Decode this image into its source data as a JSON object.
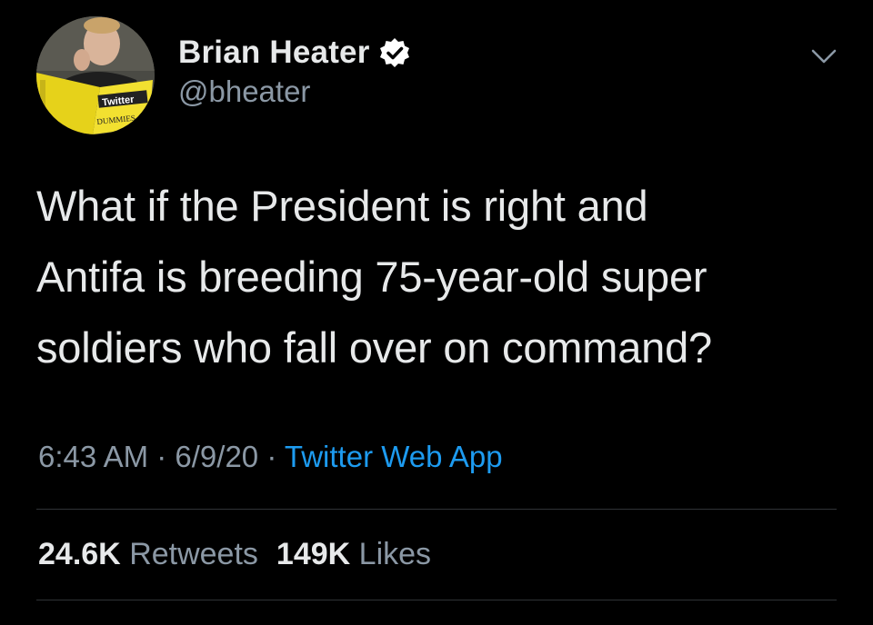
{
  "author": {
    "display_name": "Brian Heater",
    "handle": "@bheater",
    "avatar_book_title": "Twitter",
    "avatar_book_subtitle": "DUMMIES"
  },
  "tweet": {
    "text_lines": [
      "What if the President is right and",
      "Antifa is breeding 75-year-old super",
      "soldiers who fall over on command?"
    ],
    "time": "6:43 AM",
    "separator": " · ",
    "date": "6/9/20",
    "source": "Twitter Web App"
  },
  "stats": {
    "retweets_count": "24.6K",
    "retweets_label": "Retweets",
    "likes_count": "149K",
    "likes_label": "Likes"
  },
  "icons": {
    "verified": "verified-badge-icon",
    "more": "chevron-down-icon"
  },
  "colors": {
    "background": "#000000",
    "text": "#e7e9ea",
    "muted": "#8b98a5",
    "link": "#1d9bf0",
    "divider": "#2f3336"
  }
}
